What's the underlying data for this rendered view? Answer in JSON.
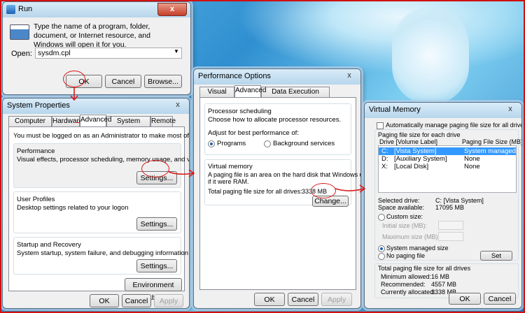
{
  "run": {
    "title": "Run",
    "close": "x",
    "description": "Type the name of a program, folder, document, or Internet resource, and Windows will open it for you.",
    "open_label": "Open:",
    "open_value": "sysdm.cpl",
    "ok": "OK",
    "cancel": "Cancel",
    "browse": "Browse..."
  },
  "sysprops": {
    "title": "System Properties",
    "close": "x",
    "tabs": [
      "Computer Name",
      "Hardware",
      "Advanced",
      "System Protection",
      "Remote"
    ],
    "admin_notice": "You must be logged on as an Administrator to make most of these changes.",
    "perf_title": "Performance",
    "perf_desc": "Visual effects, processor scheduling, memory usage, and virtual memory",
    "settings": "Settings...",
    "profiles_title": "User Profiles",
    "profiles_desc": "Desktop settings related to your logon",
    "startup_title": "Startup and Recovery",
    "startup_desc": "System startup, system failure, and debugging information",
    "env_vars": "Environment Variables...",
    "ok": "OK",
    "cancel": "Cancel",
    "apply": "Apply"
  },
  "perfopts": {
    "title": "Performance Options",
    "close": "x",
    "tabs": [
      "Visual Effects",
      "Advanced",
      "Data Execution Prevention"
    ],
    "proc_title": "Processor scheduling",
    "proc_desc": "Choose how to allocate processor resources.",
    "adjust_label": "Adjust for best performance of:",
    "programs": "Programs",
    "background": "Background services",
    "vm_title": "Virtual memory",
    "vm_desc1": "A paging file is an area on the hard disk that Windows uses as",
    "vm_desc2": "if it were RAM.",
    "total_label": "Total paging file size for all drives:",
    "total_value": "3338 MB",
    "change": "Change...",
    "ok": "OK",
    "cancel": "Cancel",
    "apply": "Apply"
  },
  "vmem": {
    "title": "Virtual Memory",
    "close": "x",
    "auto_manage": "Automatically manage paging file size for all drives",
    "per_drive": "Paging file size for each drive",
    "col_drive": "Drive  [Volume Label]",
    "col_size": "Paging File Size (MB)",
    "drives": [
      {
        "drive": "C:",
        "label": "[Vista System]",
        "size": "System managed"
      },
      {
        "drive": "D:",
        "label": "[Auxiliary System]",
        "size": "None"
      },
      {
        "drive": "X:",
        "label": "[Local Disk]",
        "size": "None"
      }
    ],
    "selected_label": "Selected drive:",
    "selected_value": "C:  [Vista System]",
    "space_label": "Space available:",
    "space_value": "17095 MB",
    "custom": "Custom size:",
    "initial": "Initial size (MB):",
    "maximum": "Maximum size (MB):",
    "system_managed": "System managed size",
    "no_paging": "No paging file",
    "set": "Set",
    "totals_title": "Total paging file size for all drives",
    "min_label": "Minimum allowed:",
    "min_value": "16 MB",
    "rec_label": "Recommended:",
    "rec_value": "4557 MB",
    "cur_label": "Currently allocated:",
    "cur_value": "3338 MB",
    "ok": "OK",
    "cancel": "Cancel"
  },
  "colors": {
    "annotation": "#d81b1b",
    "selection": "#3399ff"
  }
}
